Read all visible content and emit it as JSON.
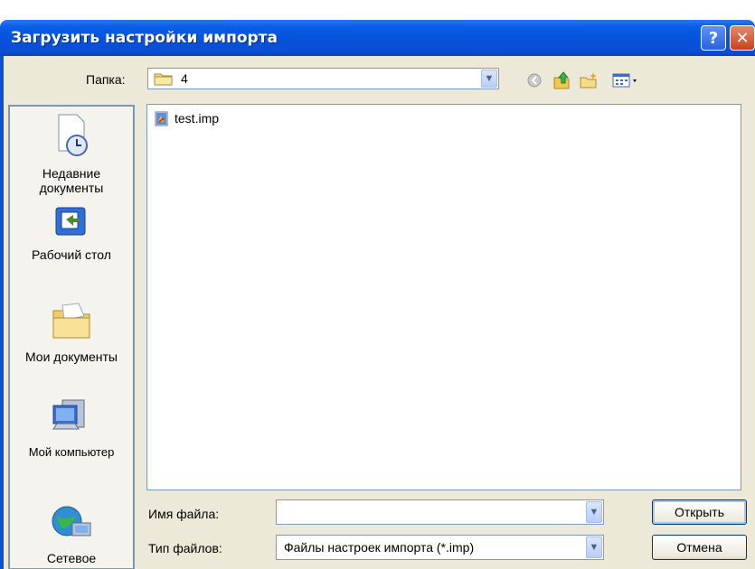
{
  "window": {
    "title": "Загрузить настройки импорта",
    "help_label": "?",
    "close_label": "✕"
  },
  "toolbar": {
    "look_in_label": "Папка:",
    "folder_value": "4",
    "icons": [
      "back-icon",
      "up-folder-icon",
      "new-folder-icon",
      "view-menu-icon"
    ]
  },
  "places": [
    {
      "label": "Недавние документы",
      "icon": "recent-documents-icon"
    },
    {
      "label": "Рабочий стол",
      "icon": "desktop-icon"
    },
    {
      "label": "Мои документы",
      "icon": "my-documents-icon"
    },
    {
      "label": "Мой компьютер",
      "icon": "my-computer-icon"
    },
    {
      "label": "Сетевое",
      "icon": "network-icon"
    }
  ],
  "files": [
    {
      "name": "test.imp",
      "icon": "imp-file-icon"
    }
  ],
  "form": {
    "filename_label": "Имя файла:",
    "filename_value": "",
    "filetype_label": "Тип файлов:",
    "filetype_value": "Файлы настроек импорта (*.imp)"
  },
  "buttons": {
    "open": "Открыть",
    "cancel": "Отмена"
  },
  "colors": {
    "titlebar": "#0653dc",
    "dialog_bg": "#ece9d8",
    "border": "#7f9db9"
  }
}
